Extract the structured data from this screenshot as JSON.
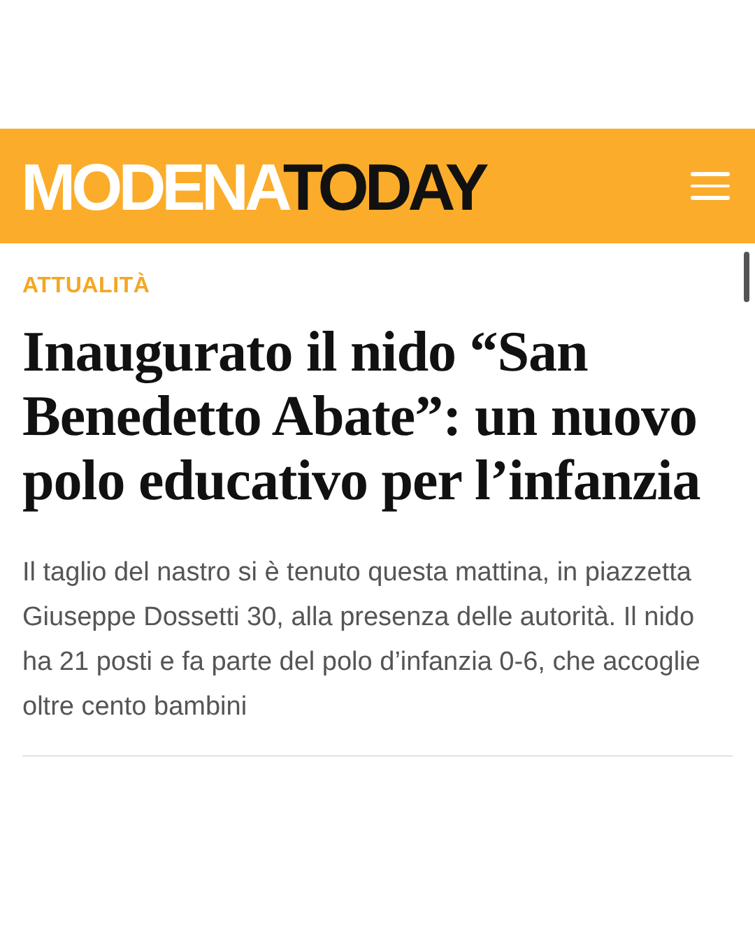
{
  "header": {
    "logo": {
      "first": "MODENA",
      "second": "TODAY"
    }
  },
  "article": {
    "category": "ATTUALITÀ",
    "title": "Inaugurato il nido “San Benedetto Abate”: un nuovo polo educativo per l’infanzia",
    "summary": "Il taglio del nastro si è tenuto questa mattina, in piazzetta Giuseppe Dossetti 30, alla presenza delle autorità. Il nido ha 21 posti e fa parte del polo d’infanzia 0-6, che accoglie oltre cento bambini"
  }
}
